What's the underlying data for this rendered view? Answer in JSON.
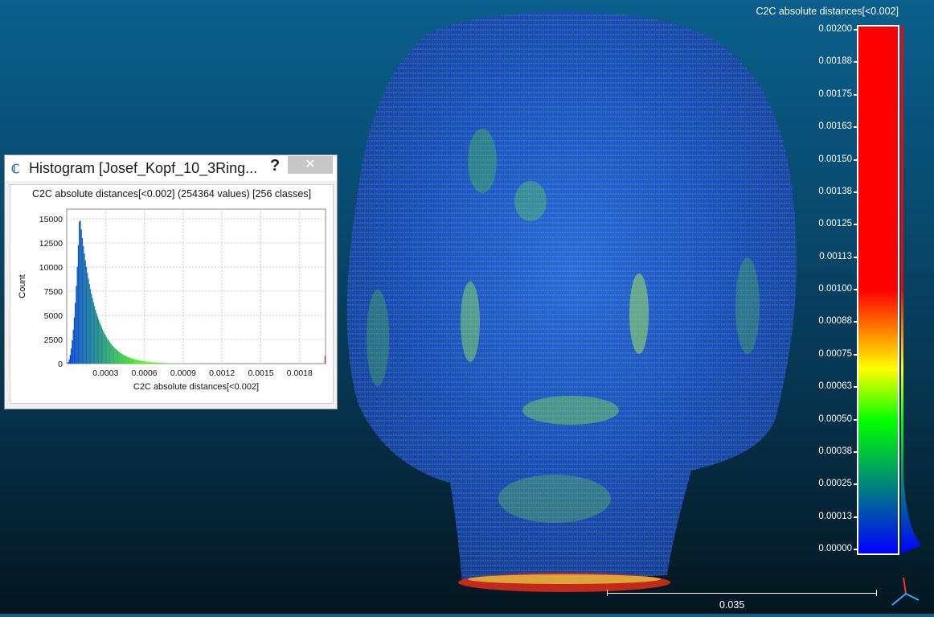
{
  "histogram_window": {
    "title": "Histogram [Josef_Kopf_10_3Ring...",
    "help_label": "?",
    "close_label": "✕",
    "header": "C2C absolute distances[<0.002] (254364 values)  [256 classes]"
  },
  "chart_data": {
    "type": "bar",
    "title": "C2C absolute distances[<0.002] (254364 values)  [256 classes]",
    "xlabel": "C2C absolute distances[<0.002]",
    "ylabel": "Count",
    "xlim": [
      0,
      0.002
    ],
    "ylim": [
      0,
      16000
    ],
    "x_ticks": [
      0.0003,
      0.0006,
      0.0009,
      0.0012,
      0.0015,
      0.0018
    ],
    "x_tick_labels": [
      "0.0003",
      "0.0006",
      "0.0009",
      "0.0012",
      "0.0015",
      "0.0018"
    ],
    "y_ticks": [
      0,
      2500,
      5000,
      7500,
      10000,
      12500,
      15000
    ],
    "y_tick_labels": [
      "0",
      "2500",
      "5000",
      "7500",
      "10000",
      "12500",
      "15000"
    ],
    "grid": true,
    "classes": 256,
    "bin_width": 7.8125e-06,
    "peak_x": 0.0001,
    "peak_count": 15500,
    "tail_spike_x": 0.00199,
    "tail_spike_count": 800
  },
  "color_scale": {
    "title": "C2C absolute distances[<0.002]",
    "labels": [
      "0.00200",
      "0.00188",
      "0.00175",
      "0.00163",
      "0.00150",
      "0.00138",
      "0.00125",
      "0.00113",
      "0.00100",
      "0.00088",
      "0.00075",
      "0.00063",
      "0.00050",
      "0.00038",
      "0.00025",
      "0.00013",
      "0.00000"
    ],
    "colors": {
      "low": "#0000ff",
      "mid_low": "#00ff00",
      "mid": "#ffff00",
      "high": "#ff0000"
    }
  },
  "scale_bar": {
    "label": "0.035"
  },
  "axis_gizmo": {
    "icon": "axis-triad-icon"
  }
}
